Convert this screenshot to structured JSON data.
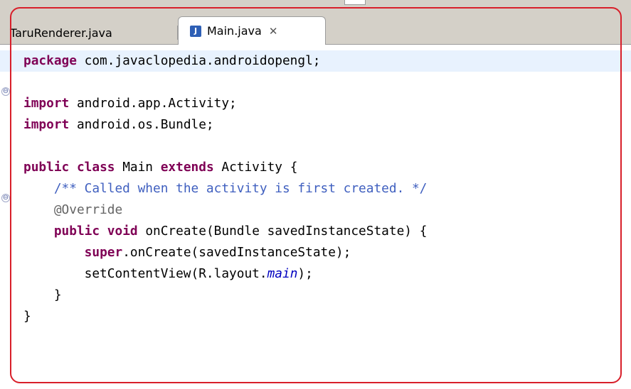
{
  "tabs": [
    {
      "label": "TaruRenderer.java",
      "active": false
    },
    {
      "label": "Main.java",
      "active": true,
      "icon": "java-file-icon",
      "close_icon": "close-icon",
      "close_glyph": "✕"
    }
  ],
  "editor": {
    "lines": [
      {
        "segments": [
          {
            "t": "package",
            "c": "kw"
          },
          {
            "t": " com.javaclopedia.androidopengl;",
            "c": ""
          }
        ],
        "current": true
      },
      {
        "segments": [
          {
            "t": "",
            "c": ""
          }
        ]
      },
      {
        "segments": [
          {
            "t": "import",
            "c": "kw"
          },
          {
            "t": " android.app.Activity;",
            "c": ""
          }
        ],
        "fold": true
      },
      {
        "segments": [
          {
            "t": "import",
            "c": "kw"
          },
          {
            "t": " android.os.Bundle;",
            "c": ""
          }
        ]
      },
      {
        "segments": [
          {
            "t": "",
            "c": ""
          }
        ]
      },
      {
        "segments": [
          {
            "t": "public",
            "c": "kw"
          },
          {
            "t": " ",
            "c": ""
          },
          {
            "t": "class",
            "c": "kw"
          },
          {
            "t": " Main ",
            "c": ""
          },
          {
            "t": "extends",
            "c": "kw"
          },
          {
            "t": " Activity {",
            "c": ""
          }
        ]
      },
      {
        "segments": [
          {
            "t": "    ",
            "c": ""
          },
          {
            "t": "/** Called when the activity is first created. */",
            "c": "cm"
          }
        ]
      },
      {
        "segments": [
          {
            "t": "    ",
            "c": ""
          },
          {
            "t": "@Override",
            "c": "an"
          }
        ],
        "fold": true
      },
      {
        "segments": [
          {
            "t": "    ",
            "c": ""
          },
          {
            "t": "public",
            "c": "kw"
          },
          {
            "t": " ",
            "c": ""
          },
          {
            "t": "void",
            "c": "kw"
          },
          {
            "t": " onCreate(Bundle savedInstanceState) {",
            "c": ""
          }
        ]
      },
      {
        "segments": [
          {
            "t": "        ",
            "c": ""
          },
          {
            "t": "super",
            "c": "kw"
          },
          {
            "t": ".onCreate(savedInstanceState);",
            "c": ""
          }
        ]
      },
      {
        "segments": [
          {
            "t": "        setContentView(R.layout.",
            "c": ""
          },
          {
            "t": "main",
            "c": "it"
          },
          {
            "t": ");",
            "c": ""
          }
        ]
      },
      {
        "segments": [
          {
            "t": "    }",
            "c": ""
          }
        ]
      },
      {
        "segments": [
          {
            "t": "}",
            "c": ""
          }
        ]
      }
    ]
  },
  "colors": {
    "keyword": "#7f0055",
    "comment": "#3f5fbf",
    "annotation": "#646464",
    "static_field": "#0000c0",
    "current_line": "#e8f2fe",
    "highlight_frame": "#d81f2a"
  }
}
